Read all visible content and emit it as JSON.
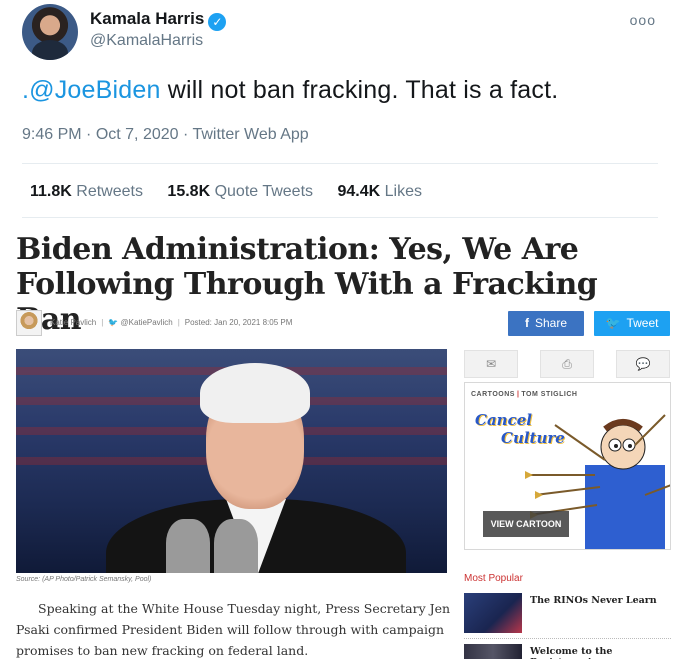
{
  "tweet": {
    "display_name": "Kamala Harris",
    "handle": "@KamalaHarris",
    "more_label": "ooo",
    "text_mention": ".@JoeBiden",
    "text_rest": " will not ban fracking. That is a fact.",
    "time": "9:46 PM",
    "date": "Oct 7, 2020",
    "app": "Twitter Web App",
    "retweets_count": "11.8K",
    "retweets_label": "Retweets",
    "quote_count": "15.8K",
    "quote_label": "Quote Tweets",
    "likes_count": "94.4K",
    "likes_label": "Likes"
  },
  "article": {
    "headline_line1": "Biden Administration: Yes, We Are",
    "headline_line2": "Following Through With a Fracking Ban",
    "author": "Katie Pavlich",
    "author_twitter": "@KatiePavlich",
    "posted": "Posted: Jan 20, 2021 8:05 PM",
    "share_label": "Share",
    "tweet_label": "Tweet",
    "photo_caption": "Source: (AP Photo/Patrick Semansky, Pool)",
    "body": "Speaking at the White House Tuesday night, Press Secretary Jen Psaki confirmed President Biden will follow through with campaign promises to ban new fracking on federal land."
  },
  "sidebar": {
    "icons": [
      "email-icon",
      "print-icon",
      "comment-icon"
    ],
    "cartoon_section": "CARTOONS",
    "cartoon_author": "TOM STIGLICH",
    "cartoon_title_1": "Cancel",
    "cartoon_title_2": "Culture",
    "view_cartoon_label": "VIEW CARTOON",
    "most_popular_label": "Most Popular",
    "popular_items": [
      {
        "title": "The RINOs Never Learn"
      },
      {
        "title": "Welcome to the Resistance!"
      }
    ]
  },
  "colors": {
    "twitter_blue": "#1da1f2",
    "facebook_blue": "#3b73c2",
    "mention_blue": "#1b95e0",
    "most_popular_red": "#cc3333"
  }
}
